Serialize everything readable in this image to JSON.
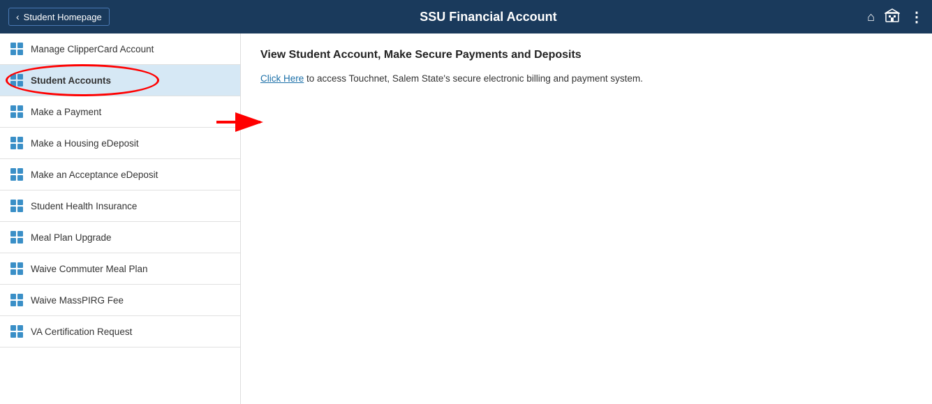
{
  "header": {
    "back_label": "Student Homepage",
    "title": "SSU Financial Account",
    "home_icon": "🏠",
    "building_icon": "🏛",
    "more_icon": "⋮"
  },
  "sidebar": {
    "items": [
      {
        "id": "manage-clippercard",
        "label": "Manage ClipperCard Account",
        "active": false
      },
      {
        "id": "student-accounts",
        "label": "Student Accounts",
        "active": true
      },
      {
        "id": "make-payment",
        "label": "Make a Payment",
        "active": false
      },
      {
        "id": "housing-edeposit",
        "label": "Make a Housing eDeposit",
        "active": false
      },
      {
        "id": "acceptance-edeposit",
        "label": "Make an Acceptance eDeposit",
        "active": false
      },
      {
        "id": "student-health-insurance",
        "label": "Student Health Insurance",
        "active": false
      },
      {
        "id": "meal-plan-upgrade",
        "label": "Meal Plan Upgrade",
        "active": false
      },
      {
        "id": "waive-commuter-meal-plan",
        "label": "Waive Commuter Meal Plan",
        "active": false
      },
      {
        "id": "waive-masspirg-fee",
        "label": "Waive MassPIRG Fee",
        "active": false
      },
      {
        "id": "va-certification-request",
        "label": "VA Certification Request",
        "active": false
      }
    ]
  },
  "main": {
    "title": "View Student Account, Make Secure Payments and Deposits",
    "link_label": "Click Here",
    "body_text": " to access Touchnet, Salem State's secure electronic billing and payment system."
  }
}
